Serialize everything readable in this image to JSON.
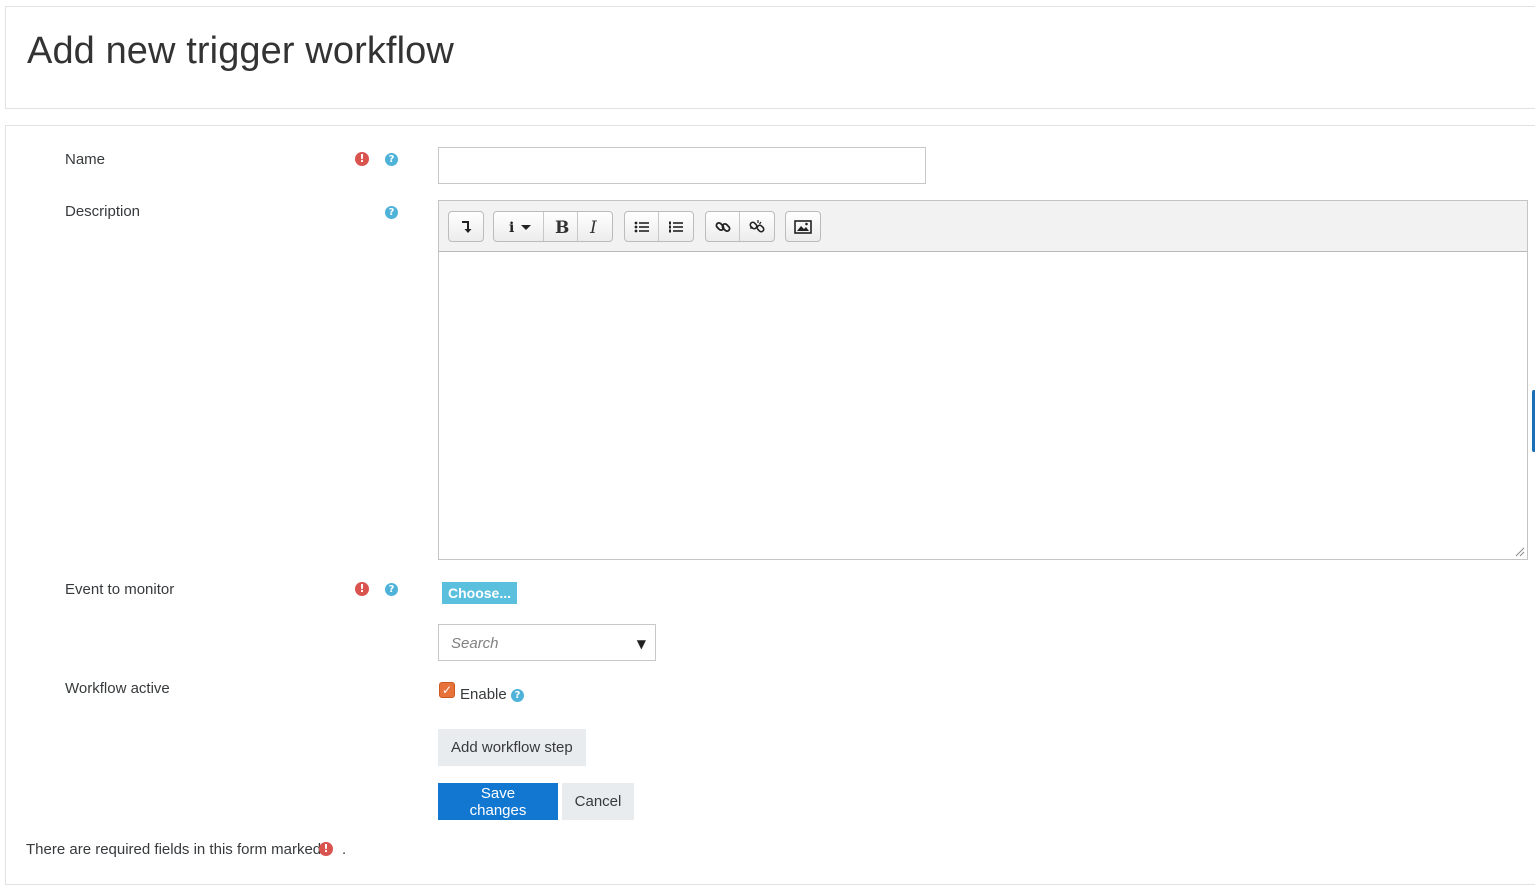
{
  "page": {
    "title": "Add new trigger workflow"
  },
  "form": {
    "name": {
      "label": "Name",
      "value": ""
    },
    "description": {
      "label": "Description"
    },
    "editor_toolbar": [
      {
        "group": "collapse",
        "buttons": [
          {
            "name": "collapse-toolbar-icon",
            "glyph": "↴"
          }
        ]
      },
      {
        "group": "style",
        "buttons": [
          {
            "name": "paragraph-styles-icon",
            "glyph": "i ▾"
          },
          {
            "name": "bold-icon",
            "glyph": "B"
          },
          {
            "name": "italic-icon",
            "glyph": "I"
          }
        ]
      },
      {
        "group": "list",
        "buttons": [
          {
            "name": "unordered-list-icon"
          },
          {
            "name": "ordered-list-icon"
          }
        ]
      },
      {
        "group": "links",
        "buttons": [
          {
            "name": "link-icon"
          },
          {
            "name": "unlink-icon"
          }
        ]
      },
      {
        "group": "image",
        "buttons": [
          {
            "name": "image-icon"
          }
        ]
      }
    ],
    "event": {
      "label": "Event to monitor",
      "choose_label": "Choose...",
      "search_placeholder": "Search"
    },
    "active": {
      "label": "Workflow active",
      "checkbox_label": "Enable",
      "checked": true
    },
    "add_step_label": "Add workflow step",
    "save_label": "Save changes",
    "cancel_label": "Cancel",
    "required_note": "There are required fields in this form marked",
    "required_note_end": "."
  },
  "icons": {
    "required": "!",
    "help": "?",
    "checkmark": "✓",
    "dropdown_arrow": "▼"
  },
  "colors": {
    "required_icon": "#d9534f",
    "help_icon": "#4fb3d9",
    "primary_button": "#1177d1",
    "choose_button": "#5bc0de",
    "checkbox": "#e8733a"
  }
}
